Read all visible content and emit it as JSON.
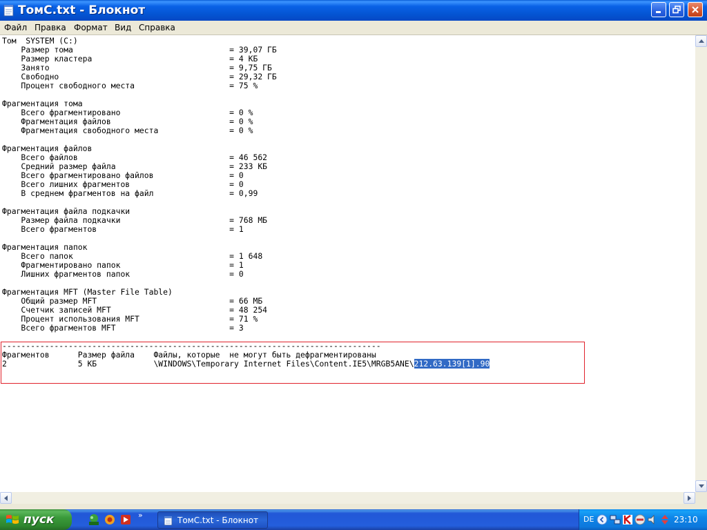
{
  "window": {
    "title": "ТомC.txt - Блокнот",
    "menu": [
      "Файл",
      "Правка",
      "Формат",
      "Вид",
      "Справка"
    ]
  },
  "document": {
    "lines": [
      "Том  SYSTEM (C:)",
      "    Размер тома                                 = 39,07 ГБ",
      "    Размер кластера                             = 4 КБ",
      "    Занято                                      = 9,75 ГБ",
      "    Свободно                                    = 29,32 ГБ",
      "    Процент свободного места                    = 75 %",
      "",
      "Фрагментация тома",
      "    Всего фрагментировано                       = 0 %",
      "    Фрагментация файлов                         = 0 %",
      "    Фрагментация свободного места               = 0 %",
      "",
      "Фрагментация файлов",
      "    Всего файлов                                = 46 562",
      "    Средний размер файла                        = 233 КБ",
      "    Всего фрагментировано файлов                = 0",
      "    Всего лишних фрагментов                     = 0",
      "    В среднем фрагментов на файл                = 0,99",
      "",
      "Фрагментация файла подкачки",
      "    Размер файла подкачки                       = 768 МБ",
      "    Всего фрагментов                            = 1",
      "",
      "Фрагментация папок",
      "    Всего папок                                 = 1 648",
      "    Фрагментировано папок                       = 1",
      "    Лишних фрагментов папок                     = 0",
      "",
      "Фрагментация MFT (Master File Table)",
      "    Общий размер MFT                            = 66 МБ",
      "    Счетчик записей MFT                         = 48 254",
      "    Процент использования MFT                   = 71 %",
      "    Всего фрагментов MFT                        = 3",
      "",
      "--------------------------------------------------------------------------------",
      "Фрагментов      Размер файла    Файлы, которые  не могут быть дефрагментированы"
    ],
    "last_line": "2               5 КБ            \\WINDOWS\\Temporary Internet Files\\Content.IE5\\MRGB5ANE\\",
    "selected_text": "212.63.139[1].90"
  },
  "taskbar": {
    "start_label": "пуск",
    "quick_launch": [
      "pro-app-icon",
      "browser-icon",
      "media-icon"
    ],
    "task_label": "ТомC.txt - Блокнот",
    "tray": {
      "lang": "DE",
      "time": "23:10",
      "icons": [
        "network-icon",
        "kaspersky-icon",
        "safely-remove-icon",
        "volume-icon"
      ]
    }
  },
  "colors": {
    "selection": "#316ac5",
    "highlight_box": "#e0202a",
    "titlebar": "#0a62e6",
    "taskbar": "#245edc",
    "start": "#3a9a3a"
  }
}
